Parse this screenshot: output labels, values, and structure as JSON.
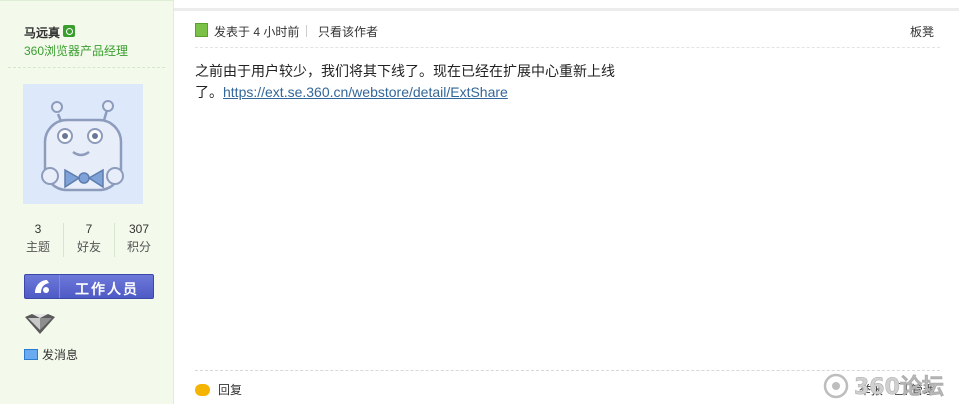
{
  "user": {
    "name": "马远真",
    "title": "360浏览器产品经理",
    "stats": [
      {
        "value": "3",
        "label": "主题"
      },
      {
        "value": "7",
        "label": "好友"
      },
      {
        "value": "307",
        "label": "积分"
      }
    ],
    "role_badge": "工作人员",
    "send_message": "发消息"
  },
  "post": {
    "posted_prefix": "发表于",
    "posted_time": "4 小时前",
    "only_author": "只看该作者",
    "floor": "板凳",
    "body_text": "之前由于用户较少，我们将其下线了。现在已经在扩展中心重新上线了。",
    "link": "https://ext.se.360.cn/webstore/detail/ExtShare",
    "reply": "回复",
    "report": "举报",
    "manage": "管理"
  },
  "watermark": "360论坛"
}
